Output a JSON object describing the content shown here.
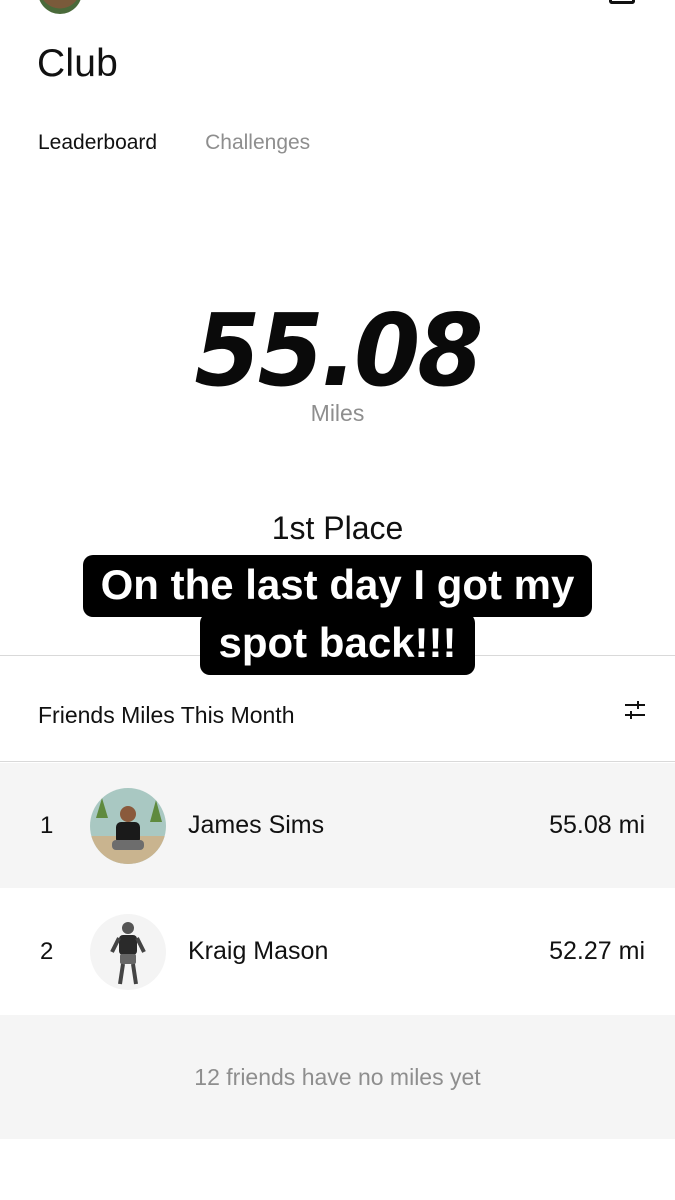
{
  "header": {
    "title": "Club"
  },
  "tabs": [
    {
      "label": "Leaderboard",
      "active": true
    },
    {
      "label": "Challenges",
      "active": false
    }
  ],
  "summary": {
    "total_miles": "55.08",
    "unit_label": "Miles",
    "place": "1st Place"
  },
  "caption": {
    "line1": "On the last day I got my",
    "line2": "spot back!!!"
  },
  "friends": {
    "header": "Friends Miles This Month",
    "filter_icon": "sliders-icon",
    "entries": [
      {
        "rank": "1",
        "name": "James Sims",
        "miles": "55.08 mi"
      },
      {
        "rank": "2",
        "name": "Kraig Mason",
        "miles": "52.27 mi"
      }
    ],
    "empty_message": "12 friends have no miles yet"
  },
  "colors": {
    "text": "#111111",
    "muted": "#8e8e8e",
    "row_shade": "#f5f5f5",
    "divider": "#d9d9d9",
    "caption_bg": "#000000"
  }
}
